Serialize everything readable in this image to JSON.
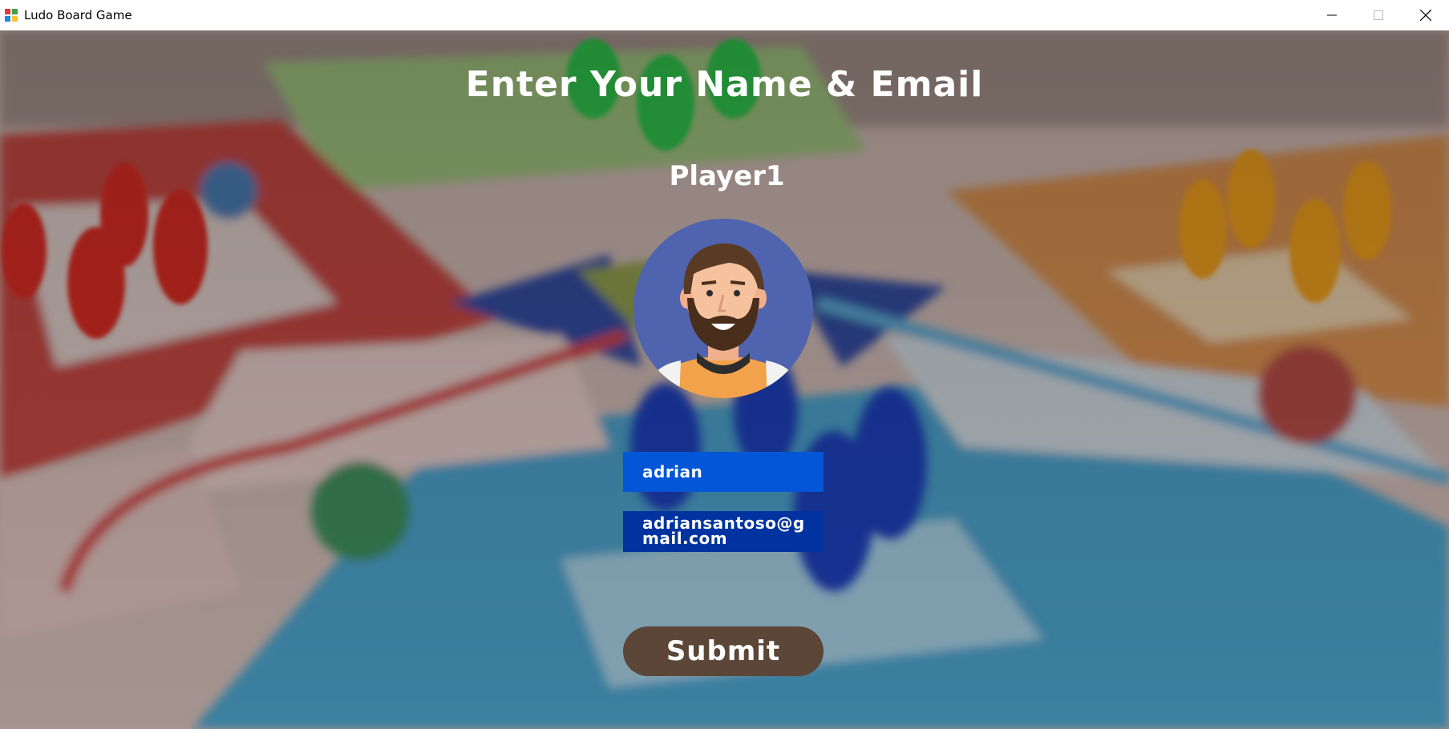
{
  "window": {
    "title": "Ludo Board Game",
    "icon": "ludo-app-icon",
    "controls": [
      "minimize-icon",
      "maximize-icon",
      "close-icon"
    ]
  },
  "form": {
    "heading": "Enter Your Name & Email",
    "player_label": "Player1",
    "avatar": "bearded-man-avatar",
    "name_value": "adrian",
    "email_value": "adriansantoso@gmail.com",
    "submit_label": "Submit"
  },
  "colors": {
    "name_field": "#0356d6",
    "email_field": "#0033a0",
    "submit_button": "#5b4638",
    "text": "#ffffff"
  }
}
